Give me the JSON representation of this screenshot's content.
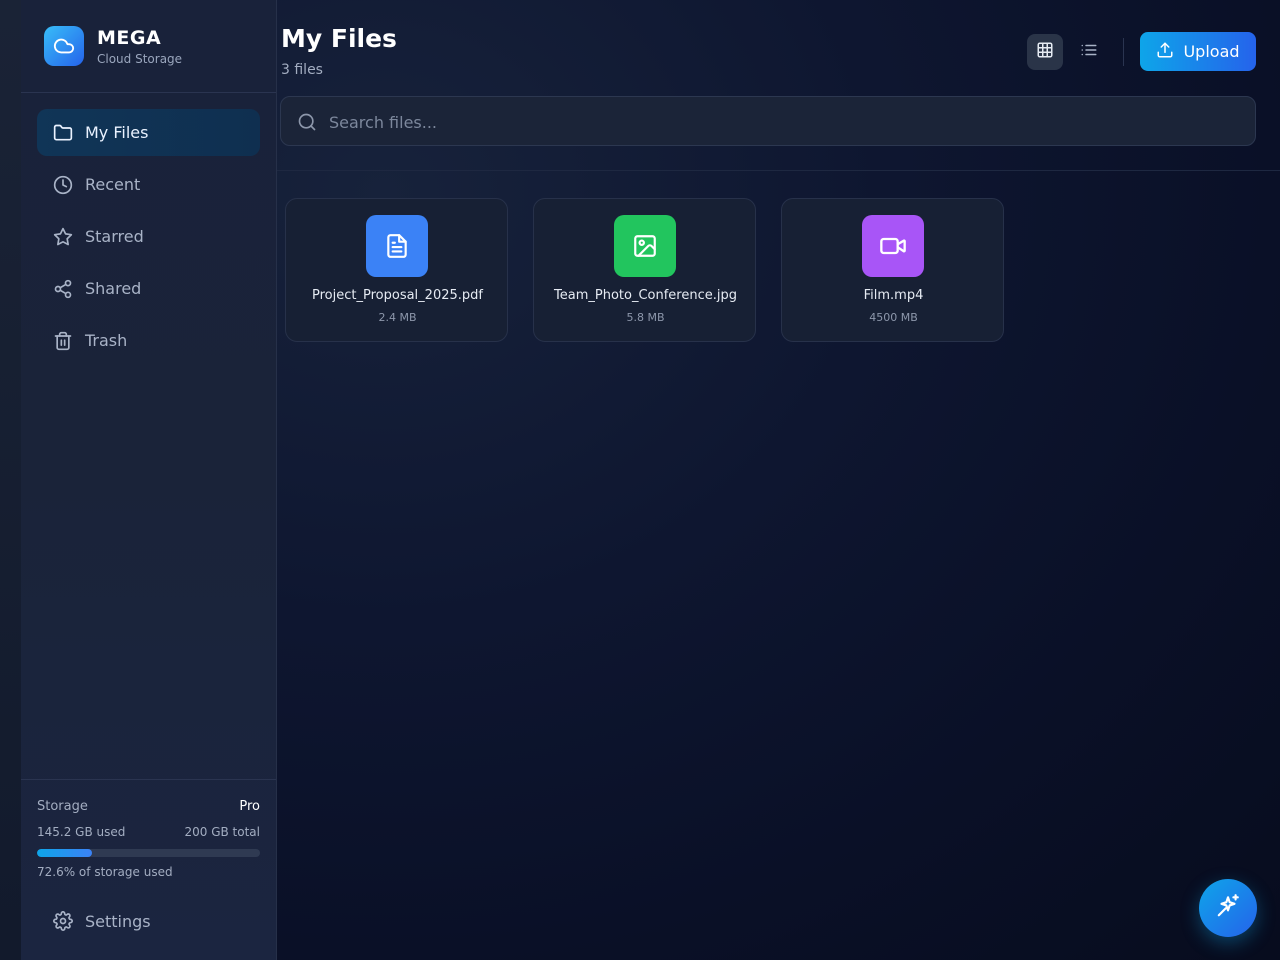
{
  "brand": {
    "name": "MEGA",
    "subtitle": "Cloud Storage"
  },
  "nav": {
    "items": [
      {
        "label": "My Files",
        "icon": "folder-icon",
        "active": true
      },
      {
        "label": "Recent",
        "icon": "clock-icon"
      },
      {
        "label": "Starred",
        "icon": "star-icon"
      },
      {
        "label": "Shared",
        "icon": "share-icon"
      },
      {
        "label": "Trash",
        "icon": "trash-icon"
      }
    ]
  },
  "storage": {
    "title": "Storage",
    "plan": "Pro",
    "used": "145.2 GB used",
    "total": "200 GB total",
    "percent_label": "72.6% of storage used",
    "bar_fill_fraction": 0.245
  },
  "settings": {
    "label": "Settings",
    "icon": "gear-icon"
  },
  "header": {
    "title": "My Files",
    "subtitle": "3 files"
  },
  "toolbar": {
    "upload_label": "Upload",
    "grid_icon": "grid-view-icon",
    "list_icon": "list-view-icon"
  },
  "search": {
    "placeholder": "Search files...",
    "value": ""
  },
  "files": [
    {
      "name": "Project_Proposal_2025.pdf",
      "size": "2.4 MB",
      "icon": "document-icon",
      "color": "#3b82f6"
    },
    {
      "name": "Team_Photo_Conference.jpg",
      "size": "5.8 MB",
      "icon": "image-icon",
      "color": "#22c55e"
    },
    {
      "name": "Film.mp4",
      "size": "4500 MB",
      "icon": "video-icon",
      "color": "#a855f7"
    }
  ],
  "colors": {
    "accent": "#0ea5e9",
    "accent_end": "#2563eb",
    "active_nav": "#103557"
  },
  "fab": {
    "icon": "sparkles-icon"
  }
}
